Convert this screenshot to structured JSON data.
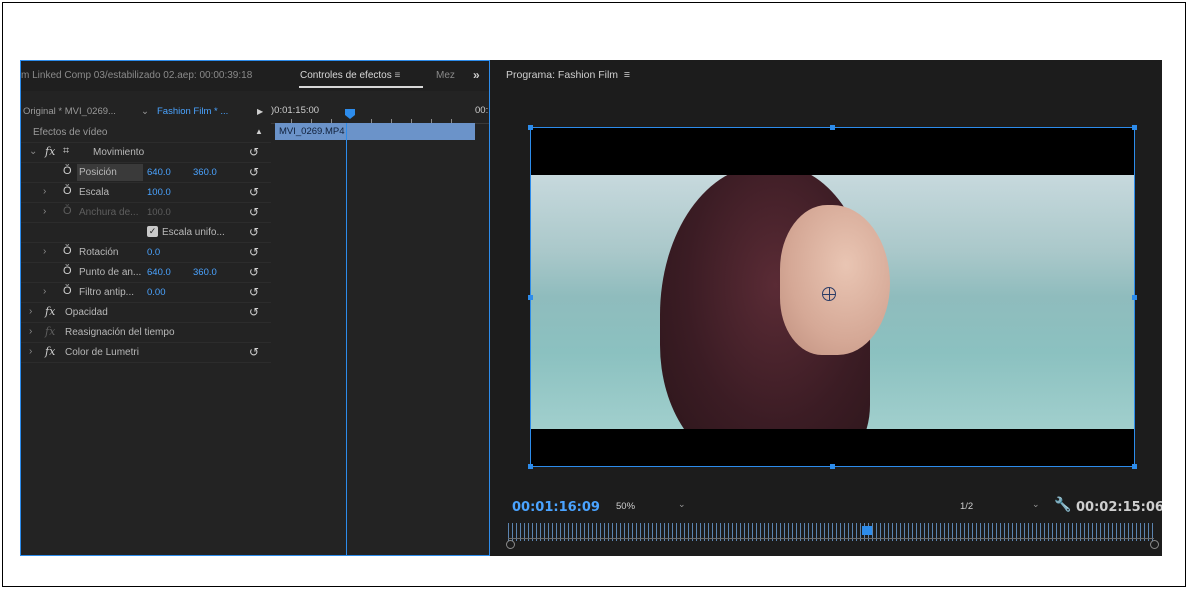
{
  "left_panel": {
    "tab_source": "m Linked Comp 03/estabilizado 02.aep: 00:00:39:18",
    "tab_effect_controls": "Controles de efectos",
    "tab_menu": "≡",
    "tab_mezcla": "Mez",
    "more": "»",
    "master_clip": "Original * MVI_0269...",
    "sequence_clip": "Fashion Film * ...",
    "ruler_start": ")0:01:15:00",
    "ruler_end": "00:",
    "clip_name": "MVI_0269.MP4",
    "section_header": "Efectos de vídeo",
    "rows": {
      "movimiento": "Movimiento",
      "posicion": "Posición",
      "posicion_x": "640.0",
      "posicion_y": "360.0",
      "escala": "Escala",
      "escala_val": "100.0",
      "anchura": "Anchura de...",
      "anchura_val": "100.0",
      "escala_uniforme": "Escala unifo...",
      "rotacion": "Rotación",
      "rotacion_val": "0.0",
      "punto_anclaje": "Punto de an...",
      "punto_x": "640.0",
      "punto_y": "360.0",
      "filtro": "Filtro antip...",
      "filtro_val": "0.00",
      "opacidad": "Opacidad",
      "reasignacion": "Reasignación del tiempo",
      "lumetri": "Color de Lumetri"
    }
  },
  "program": {
    "title": "Programa: Fashion Film",
    "menu": "≡",
    "current_timecode": "00:01:16:09",
    "zoom": "50%",
    "resolution": "1/2",
    "duration": "00:02:15:06"
  },
  "icons": {
    "reset": "↺",
    "stopwatch": "Ŏ",
    "wrench": "wrench-icon"
  },
  "colors": {
    "accent": "#2d8ceb",
    "timecode": "#4aa3ff"
  }
}
